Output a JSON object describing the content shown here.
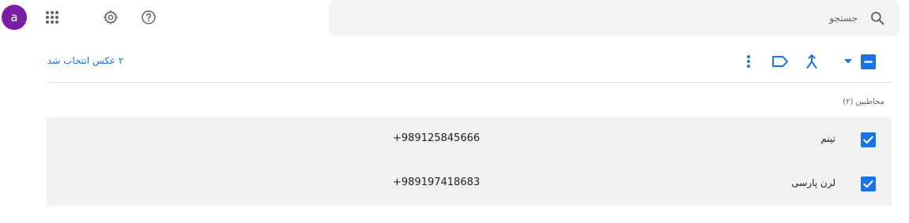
{
  "header": {
    "avatar_letter": "a",
    "avatar_color": "#7b1fa2",
    "search": {
      "placeholder": "جستجو",
      "icon": "search-icon"
    },
    "icons": [
      "apps-icon",
      "settings-icon",
      "help-icon"
    ]
  },
  "toolbar": {
    "selected_label": "۲ عکس انتخاب شد",
    "icons": [
      "more-vert-icon",
      "label-icon",
      "merge-icon",
      "dropdown-arrow-icon",
      "indeterminate-checkbox-icon"
    ],
    "accent_color": "#1a73e8"
  },
  "section": {
    "title": "مخاطبین (۲)"
  },
  "contacts": [
    {
      "name": "تینم",
      "phone": "+989125845666",
      "checked": true
    },
    {
      "name": "لرن پارسی",
      "phone": "+989197418683",
      "checked": true
    }
  ]
}
